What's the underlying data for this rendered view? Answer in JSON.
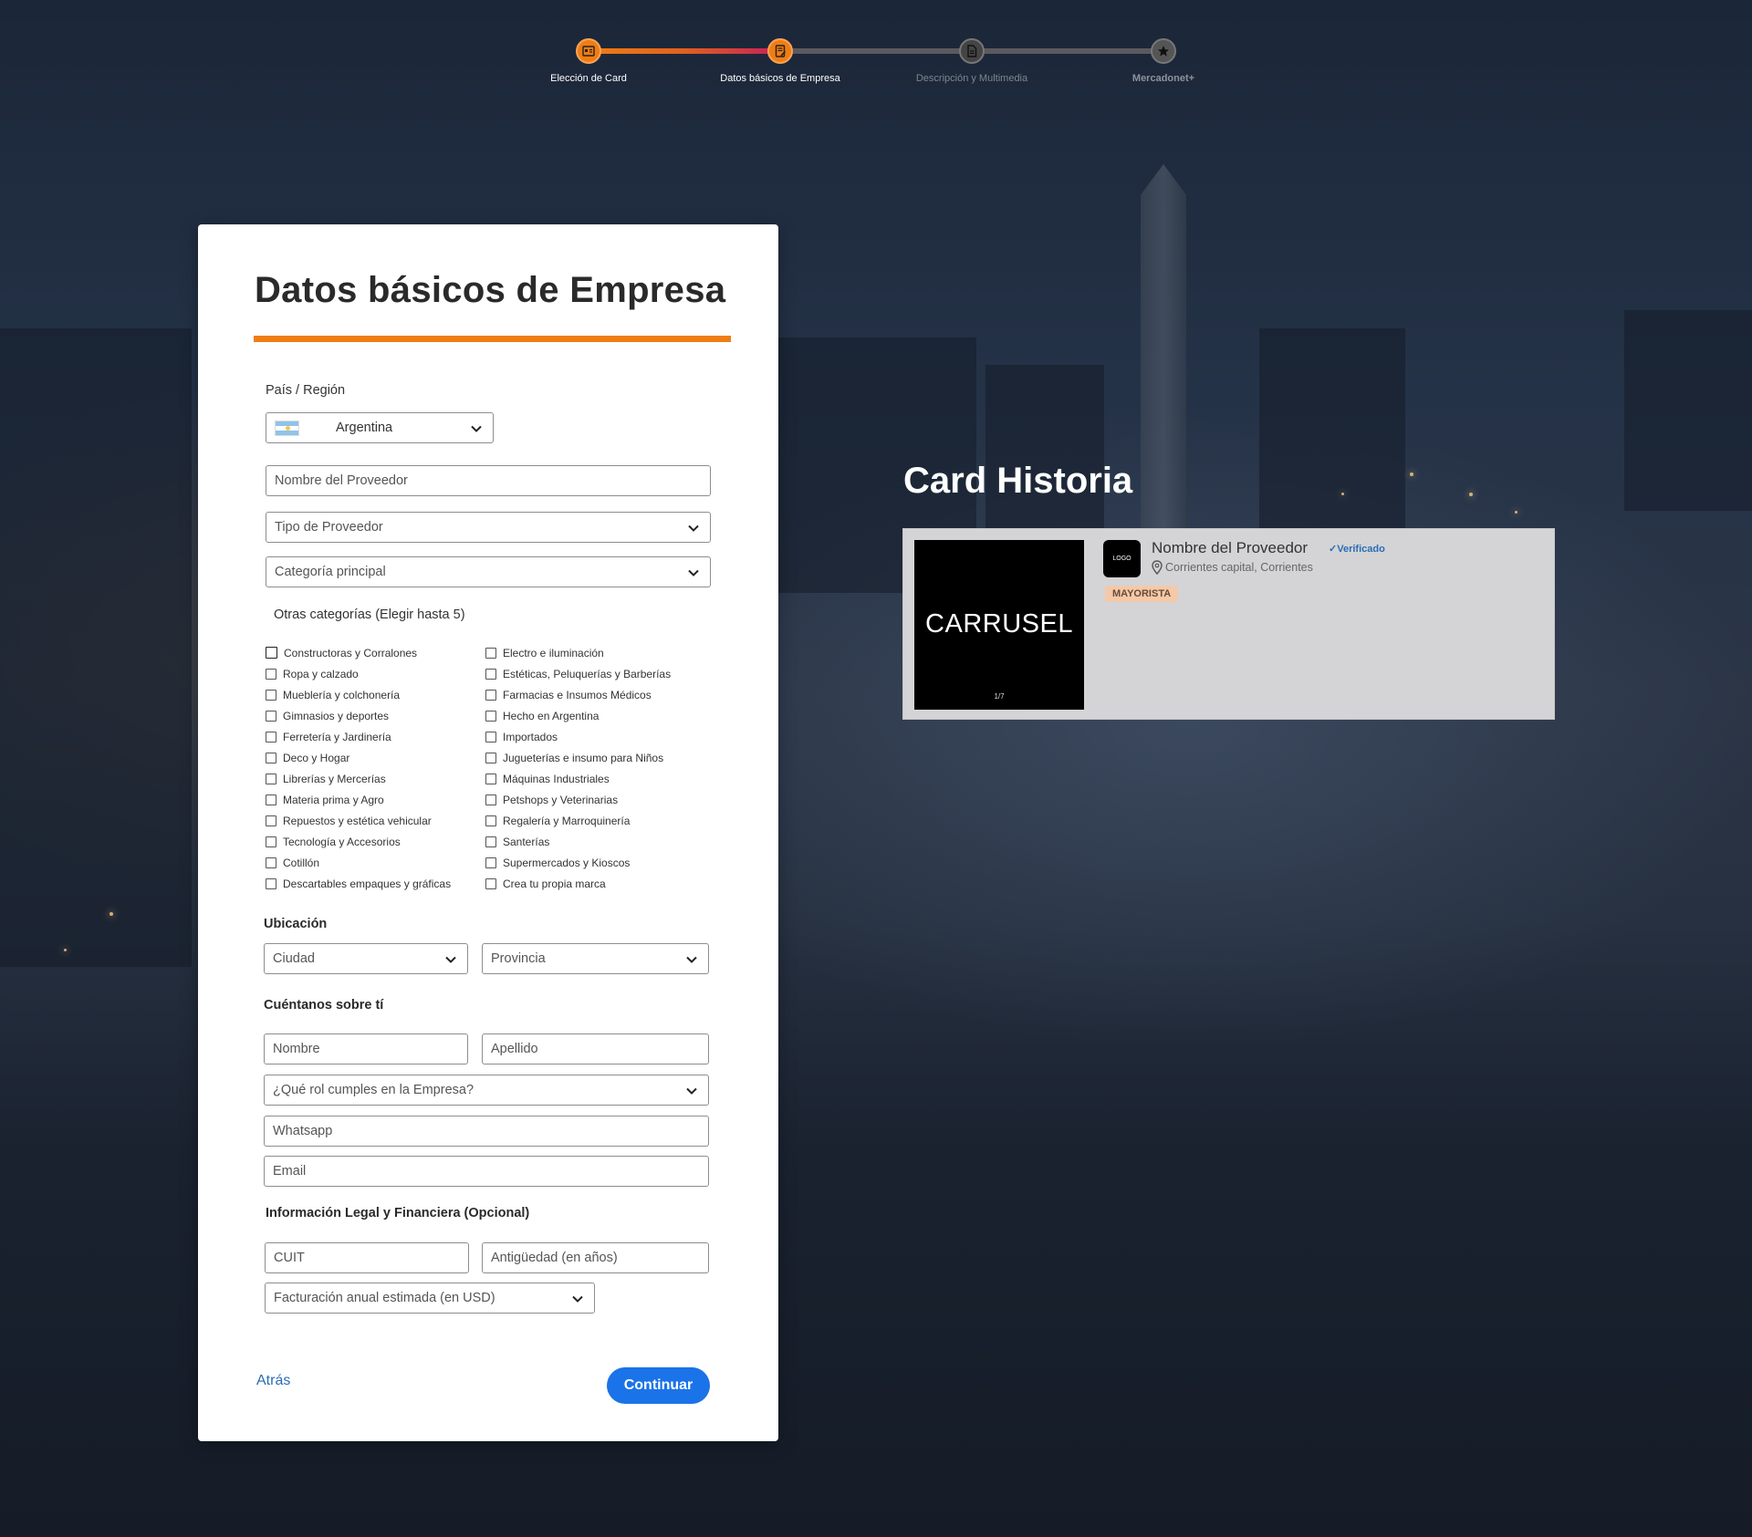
{
  "stepper": {
    "steps": [
      {
        "label": "Elección de Card",
        "state": "done",
        "icon": "id-card-icon"
      },
      {
        "label": "Datos básicos de Empresa",
        "state": "current",
        "icon": "document-edit-icon"
      },
      {
        "label": "Descripción y Multimedia",
        "state": "inactive",
        "icon": "document-icon"
      },
      {
        "label": "Mercadonet+",
        "state": "inactive",
        "icon": "star-icon"
      }
    ],
    "active_color": "#f07d12",
    "gradient_end": "#c81e5a",
    "inactive_color": "#5a5a5e"
  },
  "form": {
    "title": "Datos básicos de Empresa",
    "country_label": "País / Región",
    "country_value": "Argentina",
    "provider_name_placeholder": "Nombre del Proveedor",
    "provider_type_placeholder": "Tipo de Proveedor",
    "main_category_placeholder": "Categoría principal",
    "other_categories_label": "Otras categorías (Elegir hasta 5)",
    "categories_left": [
      "Constructoras y Corralones",
      "Ropa y calzado",
      "Mueblería y colchonería",
      "Gimnasios y deportes",
      "Ferretería y Jardinería",
      "Deco y Hogar",
      "Librerías y Mercerías",
      "Materia prima y Agro",
      "Repuestos y estética vehicular",
      "Tecnología y Accesorios",
      "Cotillón",
      "Descartables empaques y gráficas"
    ],
    "categories_right": [
      "Electro e iluminación",
      "Estéticas, Peluquerías y Barberías",
      "Farmacias e Insumos Médicos",
      "Hecho en Argentina",
      "Importados",
      "Jugueterías e insumo para Niños",
      "Máquinas Industriales",
      "Petshops y Veterinarias",
      "Regalería y Marroquinería",
      "Santerías",
      "Supermercados y Kioscos",
      "Crea tu propia marca"
    ],
    "location_label": "Ubicación",
    "city_placeholder": "Ciudad",
    "province_placeholder": "Provincia",
    "about_label": "Cuéntanos sobre tí",
    "first_name_placeholder": "Nombre",
    "last_name_placeholder": "Apellido",
    "role_placeholder": "¿Qué rol cumples en la Empresa?",
    "whatsapp_placeholder": "Whatsapp",
    "email_placeholder": "Email",
    "legal_label": "Información Legal y Financiera (Opcional)",
    "cuit_placeholder": "CUIT",
    "seniority_placeholder": "Antigüedad (en años)",
    "revenue_placeholder": "Facturación anual estimada (en USD)",
    "back_label": "Atrás",
    "continue_label": "Continuar",
    "accent_color": "#f07d12",
    "button_color": "#1a73e8"
  },
  "preview": {
    "title": "Card Historia",
    "carousel_text": "CARRUSEL",
    "carousel_counter": "1/7",
    "logo_text": "LOGO",
    "provider_name": "Nombre del Proveedor",
    "verified_label": "Verificado",
    "location": "Corrientes capital, Corrientes",
    "badge": "MAYORISTA"
  }
}
